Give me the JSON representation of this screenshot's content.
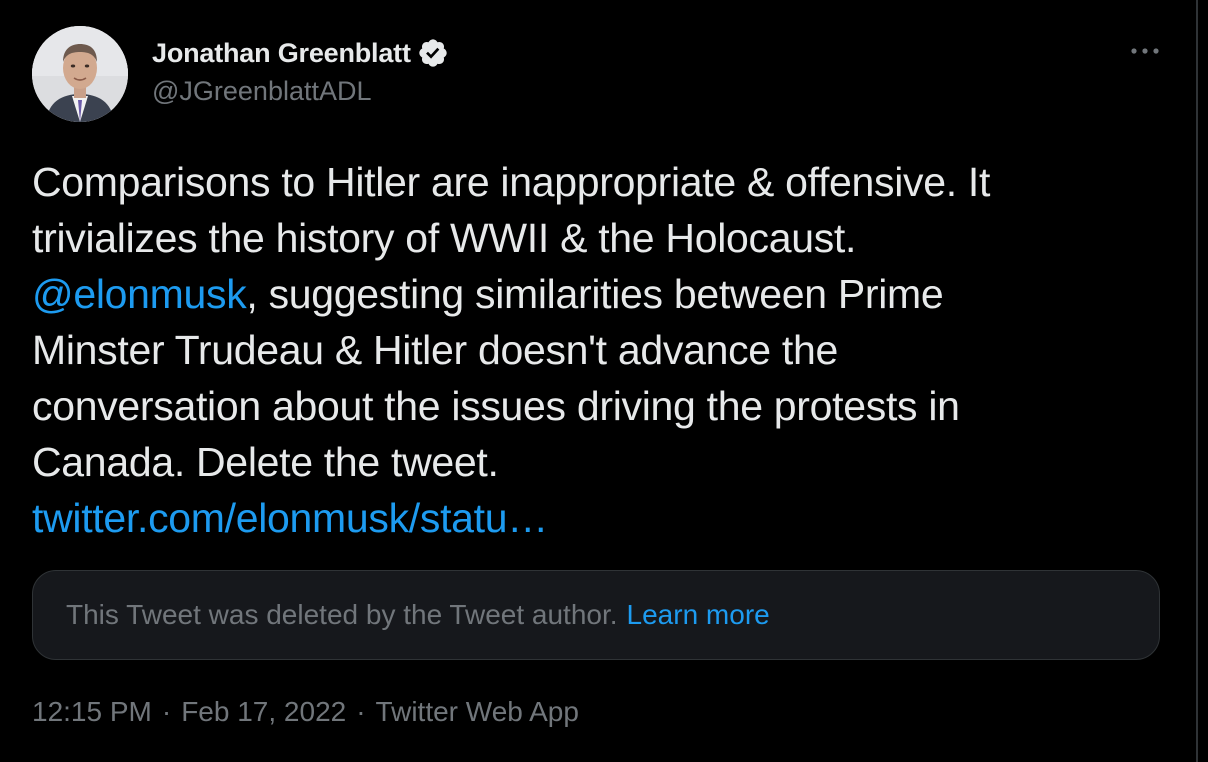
{
  "author": {
    "display_name": "Jonathan Greenblatt",
    "handle": "@JGreenblattADL",
    "verified": true
  },
  "tweet": {
    "lines": [
      [
        {
          "text": "Comparisons to Hitler are inappropriate & offensive. It",
          "link": false
        }
      ],
      [
        {
          "text": "trivializes the history of WWII & the Holocaust.",
          "link": false
        }
      ],
      [
        {
          "text": "@elonmusk",
          "link": true
        },
        {
          "text": ", suggesting similarities between Prime",
          "link": false
        }
      ],
      [
        {
          "text": "Minster Trudeau & Hitler doesn't advance the",
          "link": false
        }
      ],
      [
        {
          "text": "conversation about the issues driving the protests in",
          "link": false
        }
      ],
      [
        {
          "text": "Canada. Delete the tweet.",
          "link": false
        }
      ],
      [
        {
          "text": "twitter.com/elonmusk/statu…",
          "link": true
        }
      ]
    ]
  },
  "quoted_tweet": {
    "deleted_notice": "This Tweet was deleted by the Tweet author.",
    "learn_more_label": "Learn more"
  },
  "meta": {
    "time": "12:15 PM",
    "separator": "·",
    "date": "Feb 17, 2022",
    "source": "Twitter Web App"
  },
  "icons": {
    "verified": "verified-badge-icon",
    "more": "more-options-icon"
  },
  "colors": {
    "background": "#000000",
    "text_primary": "#e7e9ea",
    "text_secondary": "#71767b",
    "link": "#1d9bf0",
    "card_background": "#16181c",
    "border": "#2f3336"
  }
}
